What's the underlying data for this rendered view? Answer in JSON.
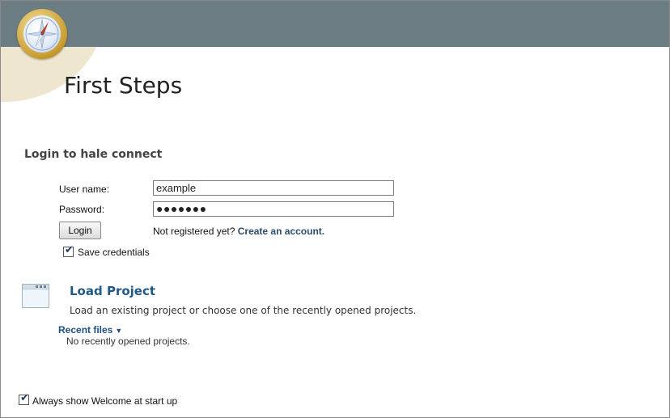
{
  "page": {
    "title": "First Steps"
  },
  "login": {
    "heading": "Login to hale connect",
    "username_label": "User name:",
    "username_value": "example",
    "password_label": "Password:",
    "password_value": "●●●●●●●",
    "login_button": "Login",
    "not_registered_text": "Not registered yet?",
    "create_account_link": "Create an account.",
    "save_credentials_label": "Save credentials",
    "save_credentials_checked": true
  },
  "load_project": {
    "title": "Load Project",
    "description": "Load an existing project or choose one of the recently opened projects.",
    "recent_files_label": "Recent files",
    "no_recent_text": "No recently opened projects."
  },
  "footer": {
    "always_show_label": "Always show Welcome at start up",
    "always_show_checked": true
  },
  "colors": {
    "header_bar": "#6d7d84",
    "accent_link": "#1f5a86",
    "arc": "#efe6cf"
  },
  "icons": [
    "compass-logo-icon",
    "window-icon",
    "chevron-down-icon",
    "checkmark-icon"
  ]
}
